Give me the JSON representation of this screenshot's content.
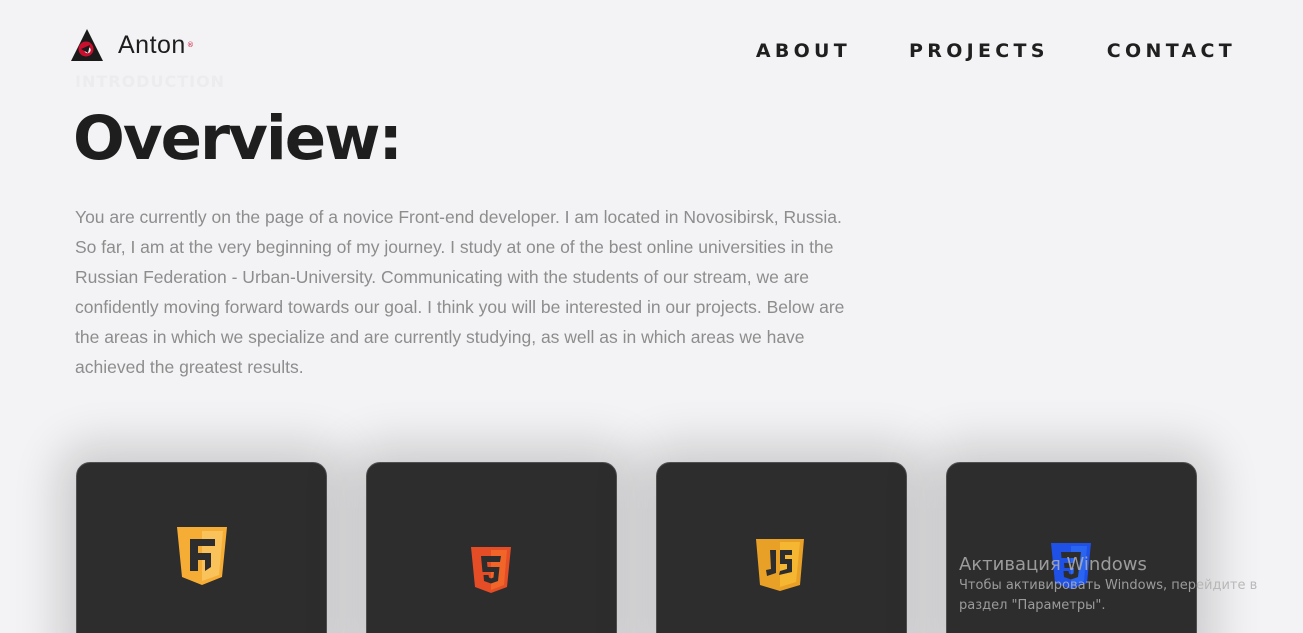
{
  "header": {
    "logo_text": "Anton",
    "logo_reg": "®",
    "nav": [
      {
        "label": "ABOUT"
      },
      {
        "label": "PROJECTS"
      },
      {
        "label": "CONTACT"
      }
    ]
  },
  "intro": {
    "eyebrow": "INTRODUCTION",
    "title": "Overview:",
    "description": "You are currently on the page of a novice Front-end developer. I am located in Novosibirsk, Russia. So far, I am at the very beginning of my journey. I study at one of the best online universities in the Russian Federation - Urban-University. Communicating with the students of our stream, we are confidently moving forward towards our goal. I think you will be interested in our projects. Below are the areas in which we specialize and are currently studying, as well as in which areas we have achieved the greatest results."
  },
  "cards": [
    {
      "icon": "framework-shield-icon",
      "glyph": "F",
      "color": "#f6ad35"
    },
    {
      "icon": "html5-icon",
      "glyph": "5",
      "color": "#e44d26"
    },
    {
      "icon": "javascript-icon",
      "glyph": "JS",
      "color": "#f0a92b"
    },
    {
      "icon": "css3-icon",
      "glyph": "3",
      "color": "#1f51e6"
    }
  ],
  "watermark": {
    "title": "Активация Windows",
    "line1": "Чтобы активировать Windows, перейдите в",
    "line2": "раздел \"Параметры\"."
  }
}
